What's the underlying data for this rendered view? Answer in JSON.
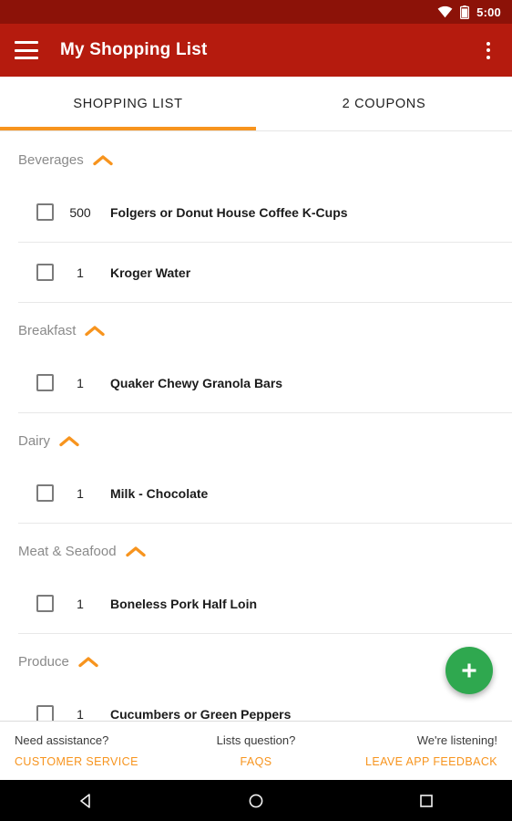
{
  "statusbar": {
    "time": "5:00",
    "wifi_icon": "wifi-icon",
    "battery_icon": "battery-icon"
  },
  "appbar": {
    "title": "My Shopping List",
    "menu_icon": "hamburger-menu-icon",
    "overflow_icon": "overflow-menu-icon",
    "background_color": "#B51B0E"
  },
  "tabs": {
    "items": [
      {
        "label": "SHOPPING LIST",
        "active": true
      },
      {
        "label": "2 COUPONS",
        "active": false
      }
    ],
    "indicator_color": "#F7941E"
  },
  "categories": [
    {
      "name": "Beverages",
      "collapse_icon": "chevron-up-icon",
      "items": [
        {
          "qty": "500",
          "name": "Folgers or Donut House Coffee K-Cups",
          "checked": false
        },
        {
          "qty": "1",
          "name": "Kroger Water",
          "checked": false
        }
      ]
    },
    {
      "name": "Breakfast",
      "collapse_icon": "chevron-up-icon",
      "items": [
        {
          "qty": "1",
          "name": "Quaker Chewy Granola Bars",
          "checked": false
        }
      ]
    },
    {
      "name": "Dairy",
      "collapse_icon": "chevron-up-icon",
      "items": [
        {
          "qty": "1",
          "name": "Milk - Chocolate",
          "checked": false
        }
      ]
    },
    {
      "name": "Meat & Seafood",
      "collapse_icon": "chevron-up-icon",
      "items": [
        {
          "qty": "1",
          "name": "Boneless Pork Half Loin",
          "checked": false
        }
      ]
    },
    {
      "name": "Produce",
      "collapse_icon": "chevron-up-icon",
      "items": [
        {
          "qty": "1",
          "name": "Cucumbers or Green Peppers",
          "checked": false
        }
      ]
    }
  ],
  "fab": {
    "icon": "plus-icon",
    "color": "#2FA84F"
  },
  "footer": {
    "columns": [
      {
        "question": "Need assistance?",
        "action": "CUSTOMER SERVICE"
      },
      {
        "question": "Lists question?",
        "action": "FAQS"
      },
      {
        "question": "We're listening!",
        "action": "LEAVE APP FEEDBACK"
      }
    ],
    "link_color": "#F7941E"
  },
  "navbar": {
    "back_icon": "back-triangle-icon",
    "home_icon": "home-circle-icon",
    "recents_icon": "recents-square-icon"
  }
}
